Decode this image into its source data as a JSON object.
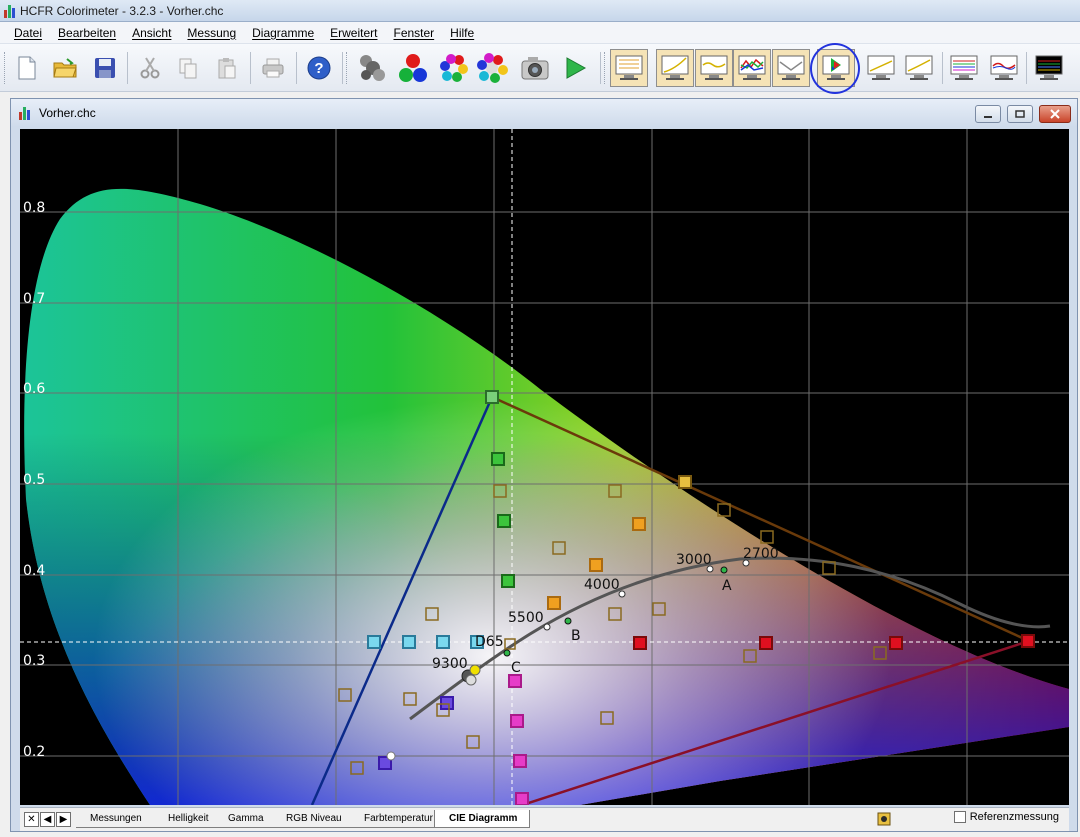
{
  "app": {
    "title": "HCFR Colorimeter - 3.2.3 - Vorher.chc"
  },
  "menu": [
    "Datei",
    "Bearbeiten",
    "Ansicht",
    "Messung",
    "Diagramme",
    "Erweitert",
    "Fenster",
    "Hilfe"
  ],
  "toolbar": {
    "icons": [
      "new-document-icon",
      "open-folder-icon",
      "save-disk-icon",
      "cut-icon",
      "copy-icon",
      "paste-icon",
      "print-icon",
      "help-icon",
      "sensor-icon",
      "rgb-balls-icon",
      "color-balls-icon",
      "grayscale-balls-icon",
      "camera-icon",
      "play-icon",
      "measures-view-icon",
      "luminance-view-icon",
      "gamma-view-icon",
      "rgb-level-view-icon",
      "color-temp-view-icon",
      "cie-diagram-view-icon",
      "view-icon-7",
      "view-icon-8",
      "view-icon-9",
      "view-icon-10",
      "view-icon-11"
    ],
    "highlighted": "cie-diagram-view-icon",
    "highlight_color": "#2233dd"
  },
  "document": {
    "title": "Vorher.chc"
  },
  "cie": {
    "y_ticks": [
      "0.8",
      "0.7",
      "0.6",
      "0.5",
      "0.4",
      "0.3",
      "0.2"
    ],
    "temperature_labels": [
      "3000",
      "2700",
      "4000",
      "5500",
      "9300",
      "D65"
    ],
    "illuminant_labels": [
      "A",
      "B",
      "C"
    ],
    "triangle_color": "#7a0a0a",
    "locus_color": "#555555"
  },
  "tabs": [
    "Messungen",
    "Helligkeit",
    "Gamma",
    "RGB Niveau",
    "Farbtemperatur",
    "CIE Diagramm"
  ],
  "active_tab": "CIE Diagramm",
  "reference": {
    "label": "Referenzmessung",
    "checked": false
  }
}
